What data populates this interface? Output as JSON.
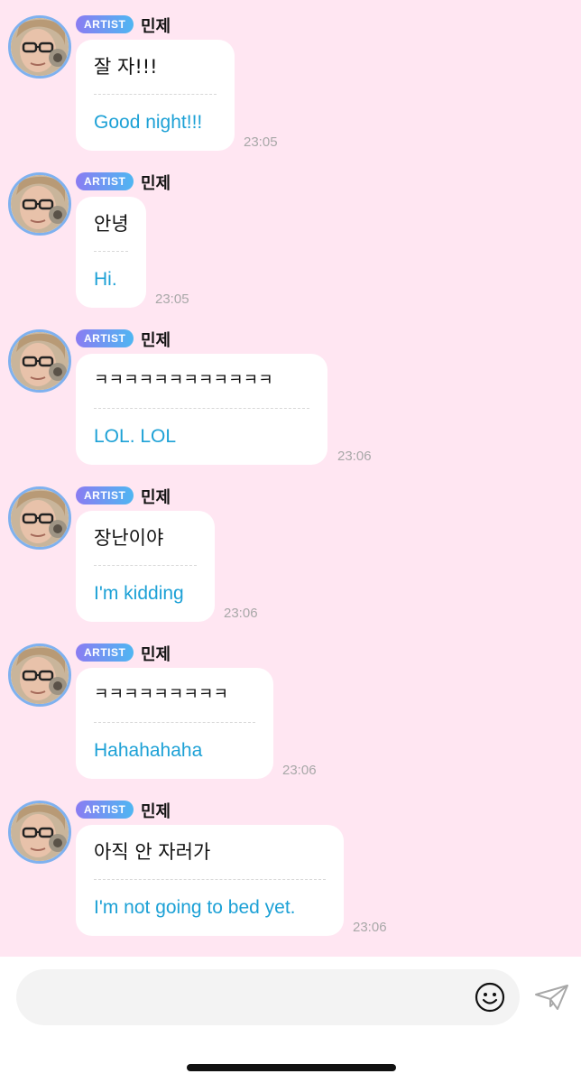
{
  "messages": [
    {
      "badge": "ARTIST",
      "sender": "민제",
      "korean": "잘 자!!!",
      "english": "Good night!!!",
      "time": "23:05"
    },
    {
      "badge": "ARTIST",
      "sender": "민제",
      "korean": "안녕",
      "english": "Hi.",
      "time": "23:05"
    },
    {
      "badge": "ARTIST",
      "sender": "민제",
      "korean": "ㅋㅋㅋㅋㅋㅋㅋㅋㅋㅋㅋㅋ",
      "english": "LOL. LOL",
      "time": "23:06"
    },
    {
      "badge": "ARTIST",
      "sender": "민제",
      "korean": "장난이야",
      "english": "I'm kidding",
      "time": "23:06"
    },
    {
      "badge": "ARTIST",
      "sender": "민제",
      "korean": "ㅋㅋㅋㅋㅋㅋㅋㅋㅋ",
      "english": "Hahahahaha",
      "time": "23:06"
    },
    {
      "badge": "ARTIST",
      "sender": "민제",
      "korean": "아직 안 자러가",
      "english": "I'm not going to bed yet.",
      "time": "23:06"
    }
  ],
  "composer": {
    "placeholder": "",
    "emoji_icon": "smiley-icon",
    "send_icon": "paper-plane-icon"
  },
  "colors": {
    "background": "#ffe6f2",
    "bubble": "#ffffff",
    "translation_text": "#1da1d6",
    "badge_gradient_start": "#8a7cf2",
    "badge_gradient_end": "#4fb6f2",
    "avatar_ring": "#7fb1ef"
  }
}
